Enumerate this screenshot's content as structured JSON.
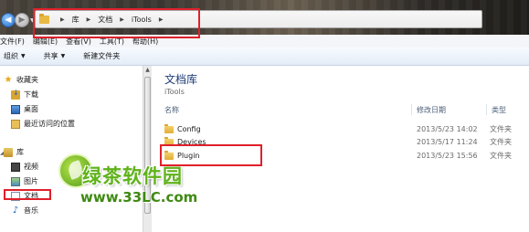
{
  "address": {
    "crumbs": [
      "库",
      "文档",
      "iTools"
    ]
  },
  "menu": {
    "items": [
      "文件(F)",
      "编辑(E)",
      "查看(V)",
      "工具(T)",
      "帮助(H)"
    ]
  },
  "toolbar": {
    "organize_label": "组织",
    "share_label": "共享",
    "new_folder_label": "新建文件夹"
  },
  "nav": {
    "favorites_label": "收藏夹",
    "downloads_label": "下载",
    "desktop_label": "桌面",
    "recent_label": "最近访问的位置",
    "libraries_label": "库",
    "videos_label": "视频",
    "pictures_label": "图片",
    "documents_label": "文档",
    "music_label": "音乐"
  },
  "content": {
    "title": "文档库",
    "subtitle": "iTools",
    "columns": {
      "name": "名称",
      "modified": "修改日期",
      "type": "类型"
    },
    "files": [
      {
        "name": "Config",
        "modified": "2013/5/23 14:02",
        "type": "文件夹"
      },
      {
        "name": "Devices",
        "modified": "2013/5/17 11:24",
        "type": "文件夹"
      },
      {
        "name": "Plugin",
        "modified": "2013/5/23 15:56",
        "type": "文件夹"
      }
    ]
  },
  "watermark": {
    "text": "绿茶软件园",
    "url": "www.33LC.com"
  },
  "colors": {
    "highlight_box": "#e0202a",
    "watermark_green": "#5fb21b"
  }
}
